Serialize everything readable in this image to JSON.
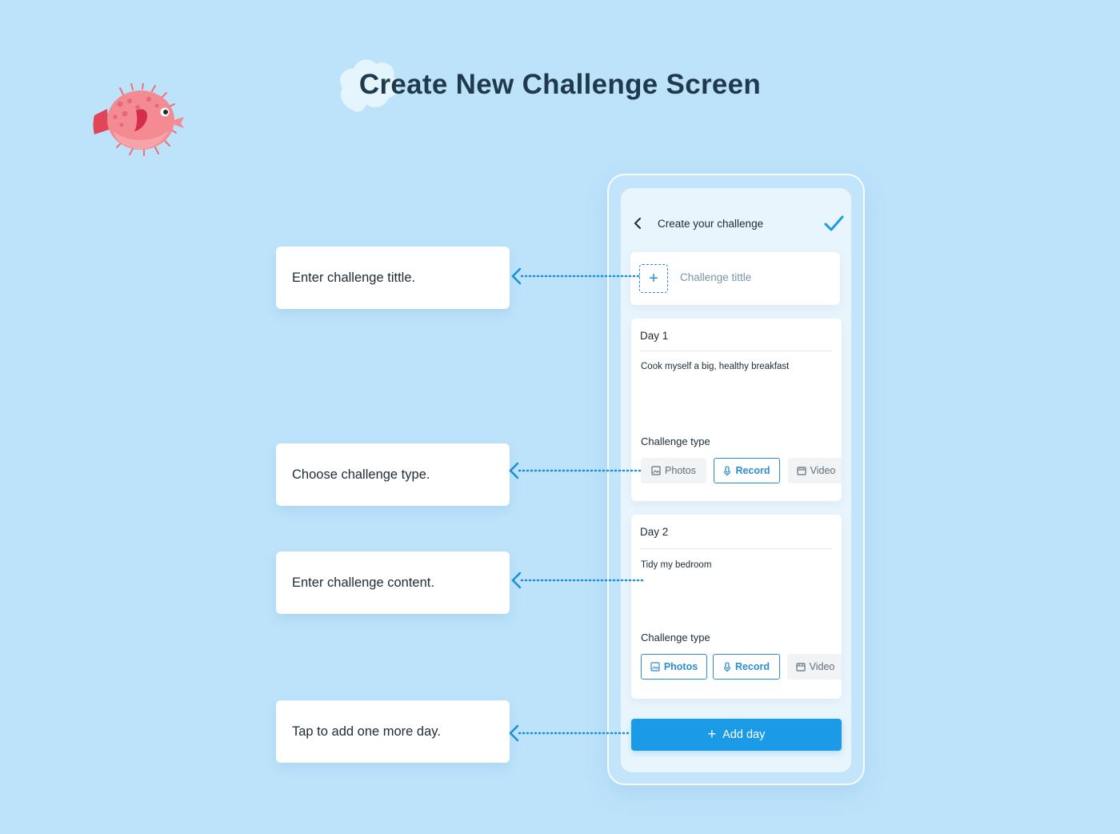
{
  "page": {
    "title": "Create New Challenge Screen"
  },
  "callouts": [
    {
      "text": "Enter challenge tittle."
    },
    {
      "text": "Choose challenge type."
    },
    {
      "text": "Enter challenge content."
    },
    {
      "text": "Tap to add one more day."
    }
  ],
  "app": {
    "header": {
      "title": "Create your challenge",
      "back_icon": "chevron-left-icon",
      "confirm_icon": "check-icon"
    },
    "title_field": {
      "placeholder": "Challenge tittle",
      "value": ""
    },
    "days": [
      {
        "label": "Day 1",
        "content": "Cook myself a big, healthy breakfast",
        "type_label": "Challenge type",
        "types": [
          {
            "label": "Photos",
            "icon": "image-icon",
            "selected": false
          },
          {
            "label": "Record",
            "icon": "microphone-icon",
            "selected": true
          },
          {
            "label": "Video",
            "icon": "video-icon",
            "selected": false
          }
        ]
      },
      {
        "label": "Day 2",
        "content": "Tidy my bedroom",
        "type_label": "Challenge type",
        "types": [
          {
            "label": "Photos",
            "icon": "image-icon",
            "selected": true
          },
          {
            "label": "Record",
            "icon": "microphone-icon",
            "selected": true
          },
          {
            "label": "Video",
            "icon": "video-icon",
            "selected": false
          }
        ]
      }
    ],
    "add_day": {
      "label": "Add day"
    }
  },
  "colors": {
    "background": "#bde3fb",
    "accent": "#1b9ae6",
    "selected_outline": "#2a8fd2",
    "fish": "#f08088"
  }
}
